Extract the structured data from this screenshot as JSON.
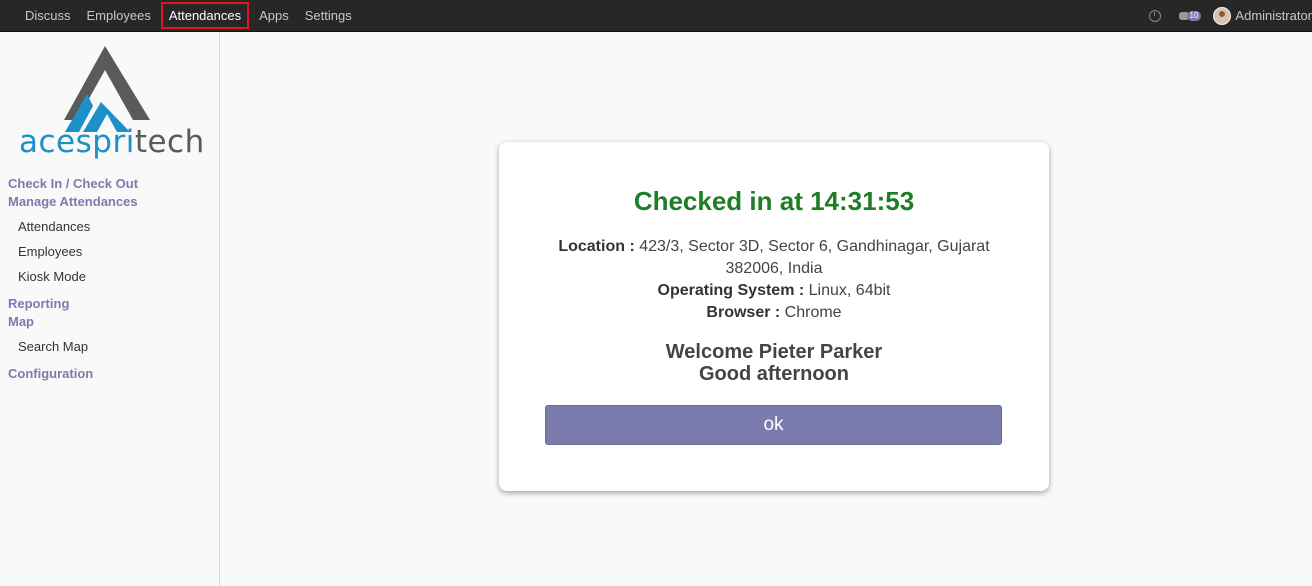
{
  "topbar": {
    "menu": [
      "Discuss",
      "Employees",
      "Attendances",
      "Apps",
      "Settings"
    ],
    "active": "Attendances",
    "notification_count": "10",
    "user_name": "Administrator"
  },
  "sidebar": {
    "logo_text_a": "ace",
    "logo_text_b": "spri",
    "logo_text_c": "tech",
    "section_checkin": "Check In / Check Out",
    "section_manage": "Manage Attendances",
    "item_attendances": "Attendances",
    "item_employees": "Employees",
    "item_kiosk": "Kiosk Mode",
    "section_reporting": "Reporting",
    "section_map": "Map",
    "item_search_map": "Search Map",
    "section_configuration": "Configuration"
  },
  "dialog": {
    "title": "Checked in at 14:31:53",
    "location_label": "Location :",
    "location_value": "423/3, Sector 3D, Sector 6, Gandhinagar, Gujarat 382006, India",
    "os_label": "Operating System :",
    "os_value": "Linux, 64bit",
    "browser_label": "Browser :",
    "browser_value": "Chrome",
    "welcome": "Welcome Pieter Parker",
    "greeting": "Good afternoon",
    "ok_label": "ok"
  },
  "colors": {
    "accent": "#7c7bad",
    "success": "#1e7e26",
    "topbar": "#272727",
    "logo_blue": "#1d8fc9",
    "logo_gray": "#5a5a5a"
  }
}
